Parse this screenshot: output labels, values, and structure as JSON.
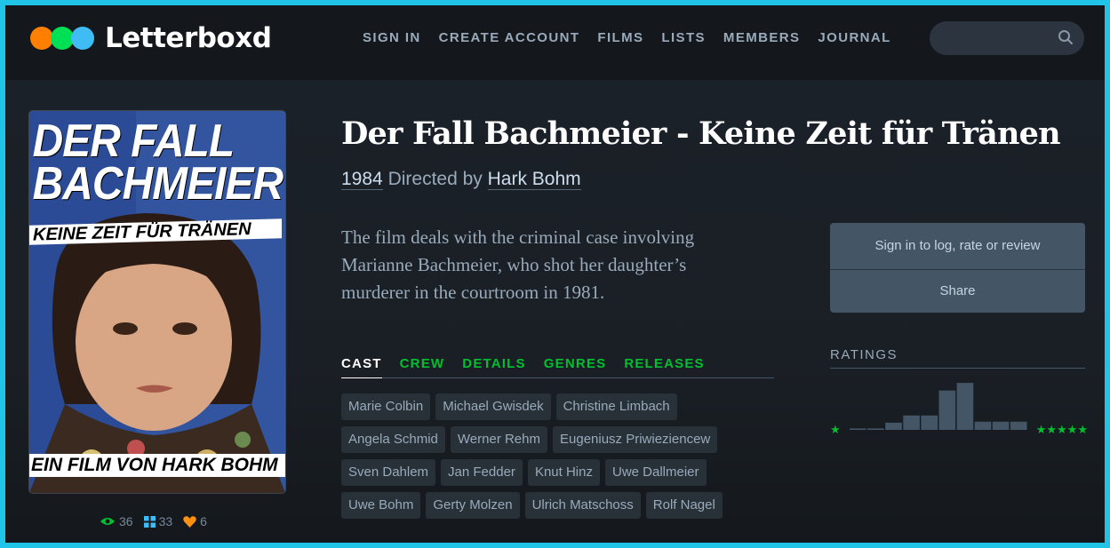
{
  "brand": {
    "name": "Letterboxd"
  },
  "nav": {
    "items": [
      "SIGN IN",
      "CREATE ACCOUNT",
      "FILMS",
      "LISTS",
      "MEMBERS",
      "JOURNAL"
    ]
  },
  "search": {
    "placeholder": ""
  },
  "poster": {
    "title_line1": "DER FALL",
    "title_line2": "BACHMEIER",
    "subtitle": "KEINE ZEIT FÜR TRÄNEN",
    "credit": "EIN FILM VON HARK BOHM"
  },
  "stats": {
    "watched": "36",
    "lists": "33",
    "likes": "6"
  },
  "film": {
    "title": "Der Fall Bachmeier - Keine Zeit für Tränen",
    "year": "1984",
    "directed_by_label": "Directed by",
    "director": "Hark Bohm",
    "synopsis": "The film deals with the criminal case involving Marianne Bachmeier, who shot her daughter’s murderer in the courtroom in 1981."
  },
  "tabs": [
    "CAST",
    "CREW",
    "DETAILS",
    "GENRES",
    "RELEASES"
  ],
  "cast": [
    "Marie Colbin",
    "Michael Gwisdek",
    "Christine Limbach",
    "Angela Schmid",
    "Werner Rehm",
    "Eugeniusz Priwieziencew",
    "Sven Dahlem",
    "Jan Fedder",
    "Knut Hinz",
    "Uwe Dallmeier",
    "Uwe Bohm",
    "Gerty Molzen",
    "Ulrich Matschoss",
    "Rolf Nagel"
  ],
  "actions": {
    "sign_in": "Sign in to log, rate or review",
    "share": "Share"
  },
  "ratings": {
    "heading": "RATINGS",
    "low_label": "★",
    "high_label": "★★★★★",
    "distribution": [
      0.03,
      0.03,
      0.15,
      0.3,
      0.3,
      0.82,
      0.98,
      0.17,
      0.17,
      0.17
    ]
  },
  "colors": {
    "accent_green": "#00c030",
    "orange": "#ff8000",
    "blue": "#40bcf4",
    "background": "#14181c",
    "frame": "#1fc4e6"
  }
}
